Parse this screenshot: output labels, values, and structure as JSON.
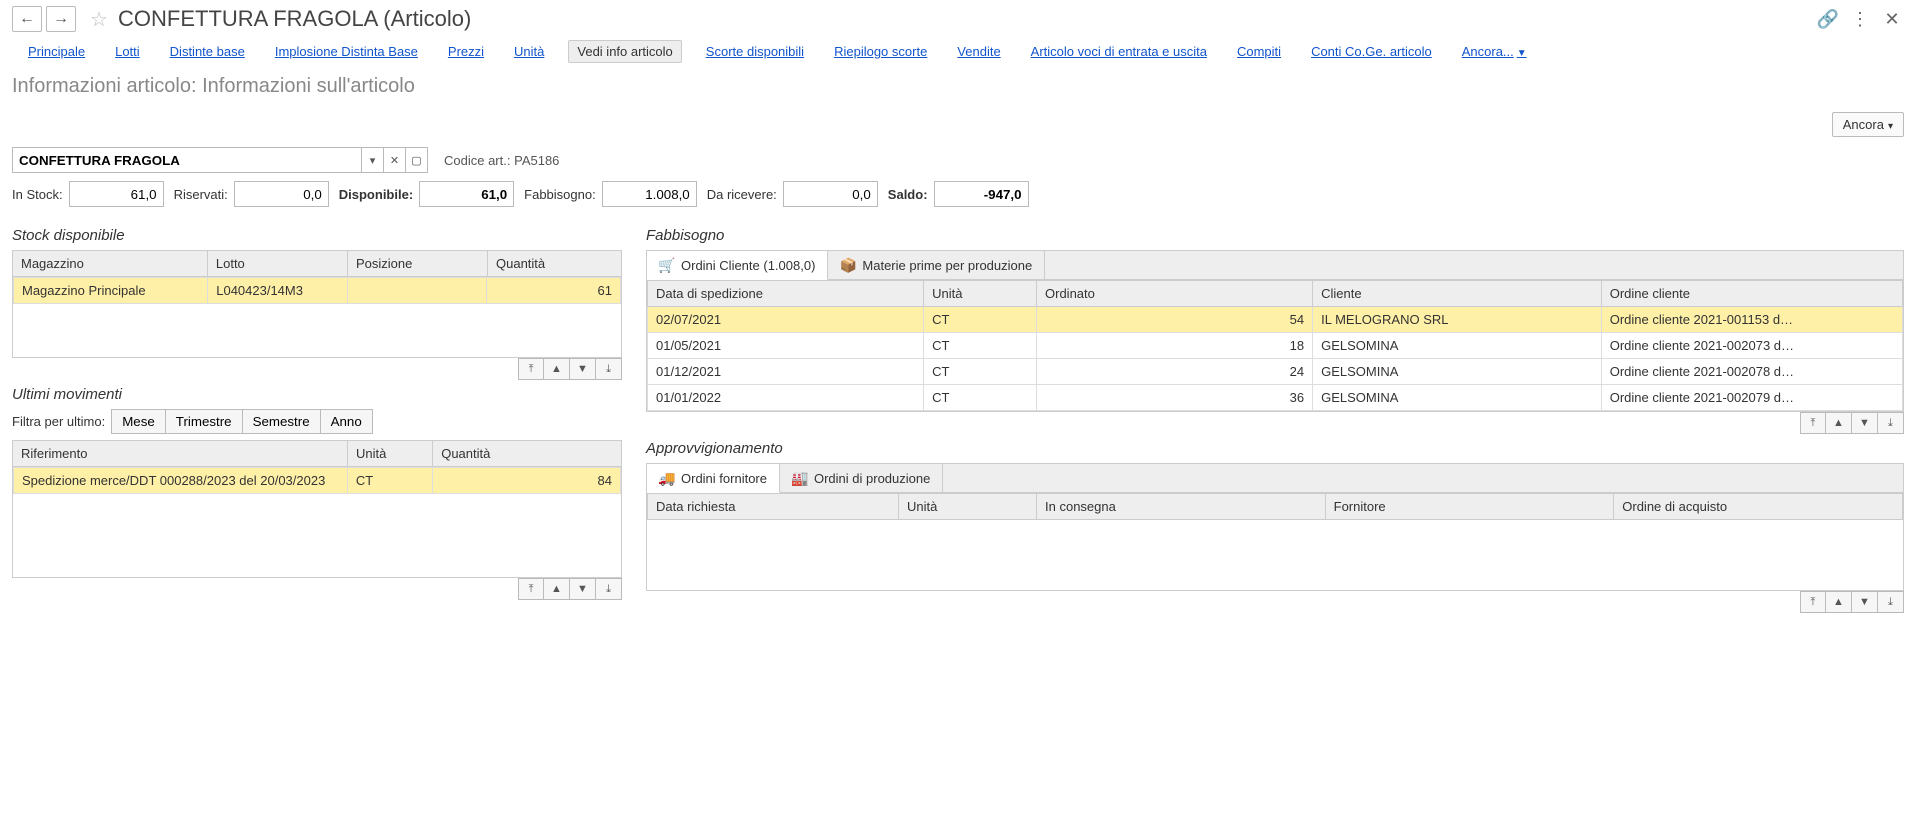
{
  "header": {
    "title": "CONFETTURA FRAGOLA (Articolo)"
  },
  "tabs": {
    "principale": "Principale",
    "lotti": "Lotti",
    "distinte": "Distinte base",
    "implosione": "Implosione Distinta Base",
    "prezzi": "Prezzi",
    "unita": "Unità",
    "vedi_info": "Vedi info articolo",
    "scorte": "Scorte disponibili",
    "riepilogo": "Riepilogo scorte",
    "vendite": "Vendite",
    "voci": "Articolo voci di entrata e uscita",
    "compiti": "Compiti",
    "conti": "Conti Co.Ge. articolo",
    "more": "Ancora..."
  },
  "subtitle": "Informazioni articolo: Informazioni sull'articolo",
  "ancora_btn": "Ancora",
  "article": {
    "name": "CONFETTURA FRAGOLA",
    "code_label": "Codice art.:",
    "code": "PA5186"
  },
  "labels": {
    "in_stock": "In Stock:",
    "riservati": "Riservati:",
    "disponibile": "Disponibile:",
    "fabbisogno": "Fabbisogno:",
    "da_ricevere": "Da ricevere:",
    "saldo": "Saldo:"
  },
  "values": {
    "in_stock": "61,0",
    "riservati": "0,0",
    "disponibile": "61,0",
    "fabbisogno": "1.008,0",
    "da_ricevere": "0,0",
    "saldo": "-947,0"
  },
  "stock": {
    "title": "Stock disponibile",
    "cols": {
      "mag": "Magazzino",
      "lotto": "Lotto",
      "pos": "Posizione",
      "qta": "Quantità"
    },
    "rows": [
      {
        "mag": "Magazzino Principale",
        "lotto": "L040423/14M3",
        "pos": "",
        "qta": "61"
      }
    ]
  },
  "movimenti": {
    "title": "Ultimi movimenti",
    "filter_label": "Filtra per ultimo:",
    "mese": "Mese",
    "trimestre": "Trimestre",
    "semestre": "Semestre",
    "anno": "Anno",
    "cols": {
      "rif": "Riferimento",
      "unita": "Unità",
      "qta": "Quantità"
    },
    "rows": [
      {
        "rif": "Spedizione merce/DDT 000288/2023 del 20/03/2023",
        "unita": "CT",
        "qta": "84"
      }
    ]
  },
  "fab": {
    "title": "Fabbisogno",
    "tab_ordini": "Ordini Cliente (1.008,0)",
    "tab_materie": "Materie prime per produzione",
    "cols": {
      "data": "Data di spedizione",
      "unita": "Unità",
      "ordinato": "Ordinato",
      "cliente": "Cliente",
      "ordine": "Ordine cliente"
    },
    "rows": [
      {
        "data": "02/07/2021",
        "unita": "CT",
        "ordinato": "54",
        "cliente": "IL MELOGRANO SRL",
        "ordine": "Ordine cliente 2021-001153 d…"
      },
      {
        "data": "01/05/2021",
        "unita": "CT",
        "ordinato": "18",
        "cliente": "GELSOMINA",
        "ordine": "Ordine cliente 2021-002073 d…"
      },
      {
        "data": "01/12/2021",
        "unita": "CT",
        "ordinato": "24",
        "cliente": "GELSOMINA",
        "ordine": "Ordine cliente 2021-002078 d…"
      },
      {
        "data": "01/01/2022",
        "unita": "CT",
        "ordinato": "36",
        "cliente": "GELSOMINA",
        "ordine": "Ordine cliente 2021-002079 d…"
      }
    ]
  },
  "approv": {
    "title": "Approvvigionamento",
    "tab_fornitore": "Ordini fornitore",
    "tab_produzione": "Ordini di produzione",
    "cols": {
      "data": "Data richiesta",
      "unita": "Unità",
      "cons": "In consegna",
      "forn": "Fornitore",
      "ordine": "Ordine di acquisto"
    }
  }
}
